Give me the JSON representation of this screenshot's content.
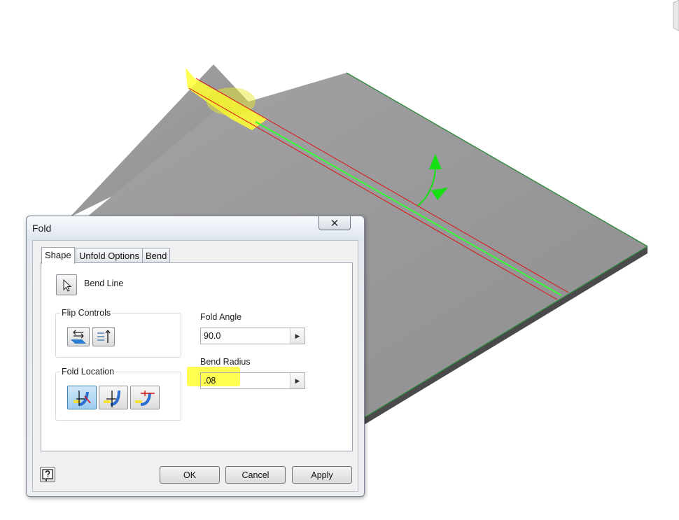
{
  "dialog": {
    "title": "Fold",
    "close_glyph": "✕",
    "tabs": [
      {
        "label": "Shape",
        "active": true
      },
      {
        "label": "Unfold Options",
        "active": false
      },
      {
        "label": "Bend",
        "active": false
      }
    ],
    "bend_line": {
      "label": "Bend Line",
      "icon": "cursor-arrow-icon"
    },
    "flip_controls": {
      "label": "Flip Controls",
      "icons": [
        "flip-side-icon",
        "flip-direction-icon"
      ]
    },
    "fold_location": {
      "label": "Fold Location",
      "icons": [
        "centerline-of-bend-icon",
        "start-of-bend-icon",
        "end-of-bend-icon"
      ],
      "selected_index": 0
    },
    "fold_angle": {
      "label": "Fold Angle",
      "value": "90.0"
    },
    "bend_radius": {
      "label": "Bend Radius",
      "value": ".08"
    },
    "buttons": {
      "ok": "OK",
      "cancel": "Cancel",
      "apply": "Apply"
    },
    "help_icon": "help-icon"
  },
  "scene": {
    "sheet_color": "#9b9a9c",
    "edge_color": "#2a8a3a",
    "bend_line_color": "#33ff33",
    "bend_zone_color": "#e01010",
    "highlight_color": "#ffff33",
    "arrow_color": "#14e014"
  }
}
